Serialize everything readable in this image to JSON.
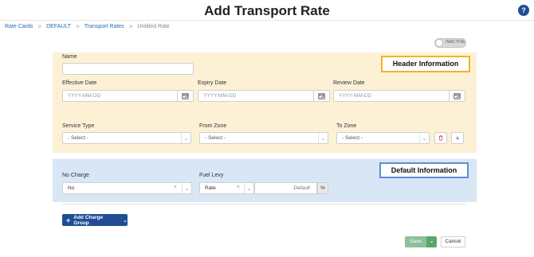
{
  "page": {
    "title": "Add Transport Rate",
    "help_label": "?"
  },
  "breadcrumb": {
    "items": [
      "Rate Cards",
      "DEFAULT",
      "Transport Rates",
      "Untitled Rate"
    ],
    "separator": ">"
  },
  "status_toggle": {
    "label": "INACTIVE",
    "active": false
  },
  "header_section": {
    "tag": "Header Information",
    "color": "#fdf1d5",
    "name": {
      "label": "Name",
      "value": ""
    },
    "effective_date": {
      "label": "Effective Date",
      "placeholder": "YYYY-MM-DD"
    },
    "expiry_date": {
      "label": "Expiry Date",
      "placeholder": "YYYY-MM-DD"
    },
    "review_date": {
      "label": "Review Date",
      "placeholder": "YYYY-MM-DD"
    },
    "service_type": {
      "label": "Service Type",
      "value": "- Select -"
    },
    "from_zone": {
      "label": "From Zone",
      "value": "- Select -"
    },
    "to_zone": {
      "label": "To Zone",
      "value": "- Select -"
    }
  },
  "default_section": {
    "tag": "Default Information",
    "color": "#d9e6f5",
    "no_charge": {
      "label": "No Charge",
      "value": "No"
    },
    "fuel_levy": {
      "label": "Fuel Levy",
      "type_value": "Rate",
      "placeholder": "Default",
      "unit": "%"
    }
  },
  "actions": {
    "add_charge_group": "Add Charge Group",
    "save": "Save",
    "cancel": "Cancel"
  },
  "colors": {
    "primary": "#1f4e96",
    "save": "#8cc09a",
    "header_tag_border": "#f0b429",
    "default_tag_border": "#5b8fd6"
  }
}
